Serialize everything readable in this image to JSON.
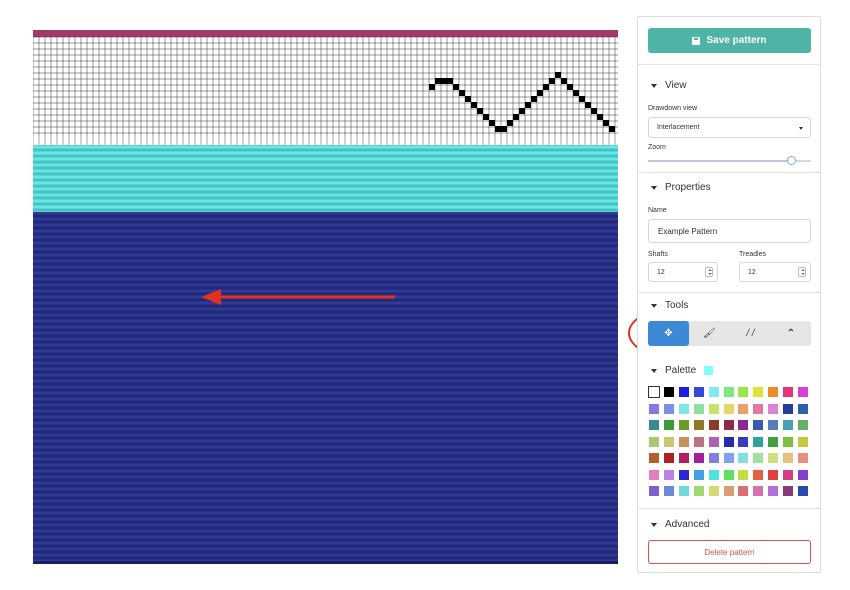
{
  "sidebar": {
    "save_label": "Save pattern",
    "view": {
      "title": "View",
      "drawdown_label": "Drawdown view",
      "drawdown_value": "Interlacement",
      "zoom_label": "Zoom",
      "zoom_level": 0.88
    },
    "properties": {
      "title": "Properties",
      "name_label": "Name",
      "name_value": "Example Pattern",
      "shafts_label": "Shafts",
      "shafts_value": "12",
      "treadles_label": "Treadles",
      "treadles_value": "12"
    },
    "tools": {
      "title": "Tools",
      "items": [
        {
          "icon": "move-icon",
          "glyph": "✥",
          "active": true
        },
        {
          "icon": "brush-icon",
          "glyph": "🖌",
          "active": false
        },
        {
          "icon": "straight-draw-icon",
          "glyph": "/ /",
          "active": false
        },
        {
          "icon": "point-draw-icon",
          "glyph": "⌃",
          "active": false
        }
      ]
    },
    "palette": {
      "title": "Palette",
      "current_color": "#80ffff",
      "rows": [
        [
          "#ffffff",
          "#000000",
          "#1d1de8",
          "#3448e0",
          "#7fe9f4",
          "#7ee87f",
          "#9be44a",
          "#d9e436",
          "#f08a24",
          "#e8357a",
          "#d940d8"
        ],
        [
          "#8877e0",
          "#7b8fe8",
          "#80e6e6",
          "#8ee0a0",
          "#c4e46c",
          "#e8d66a",
          "#e8a068",
          "#e07aa0",
          "#d884d8",
          "#243ca0",
          "#3060a8"
        ],
        [
          "#3a8c8c",
          "#3c9a3c",
          "#6a9a2a",
          "#8c7a2a",
          "#8c3a2a",
          "#8c2a4a",
          "#8c2a8c",
          "#3a5ab0",
          "#5a7ac0",
          "#4aa0b0",
          "#64b064"
        ],
        [
          "#a8c870",
          "#c8c870",
          "#c89060",
          "#c07080",
          "#b060b0",
          "#2a2ab0",
          "#3a3ac0",
          "#30a0a0",
          "#40a040",
          "#78c040",
          "#c8c840"
        ],
        [
          "#b06030",
          "#b02020",
          "#b02060",
          "#a020a0",
          "#8080e0",
          "#80a0f0",
          "#80e0e0",
          "#a0e0a0",
          "#d0e080",
          "#e8c080",
          "#e89080"
        ],
        [
          "#e080c0",
          "#c080e0",
          "#2a2ad0",
          "#40a0e0",
          "#50e0e0",
          "#60e060",
          "#c0e040",
          "#e06040",
          "#e04040",
          "#d04080",
          "#8040d0"
        ],
        [
          "#8060d0",
          "#6a8ad8",
          "#70d8d8",
          "#a0d870",
          "#d8d870",
          "#d8a070",
          "#d87070",
          "#d870b0",
          "#b070d8",
          "#8a3a7a",
          "#2a4ab0"
        ]
      ]
    },
    "advanced": {
      "title": "Advanced",
      "delete_label": "Delete pattern"
    }
  },
  "canvas": {
    "colors": {
      "warp": "#a33a6a",
      "weft_light": "#6ff0ee",
      "weft_dark": "#353f9c",
      "threading_bar": "#a33a6a",
      "annotation": "#e0321f"
    }
  }
}
